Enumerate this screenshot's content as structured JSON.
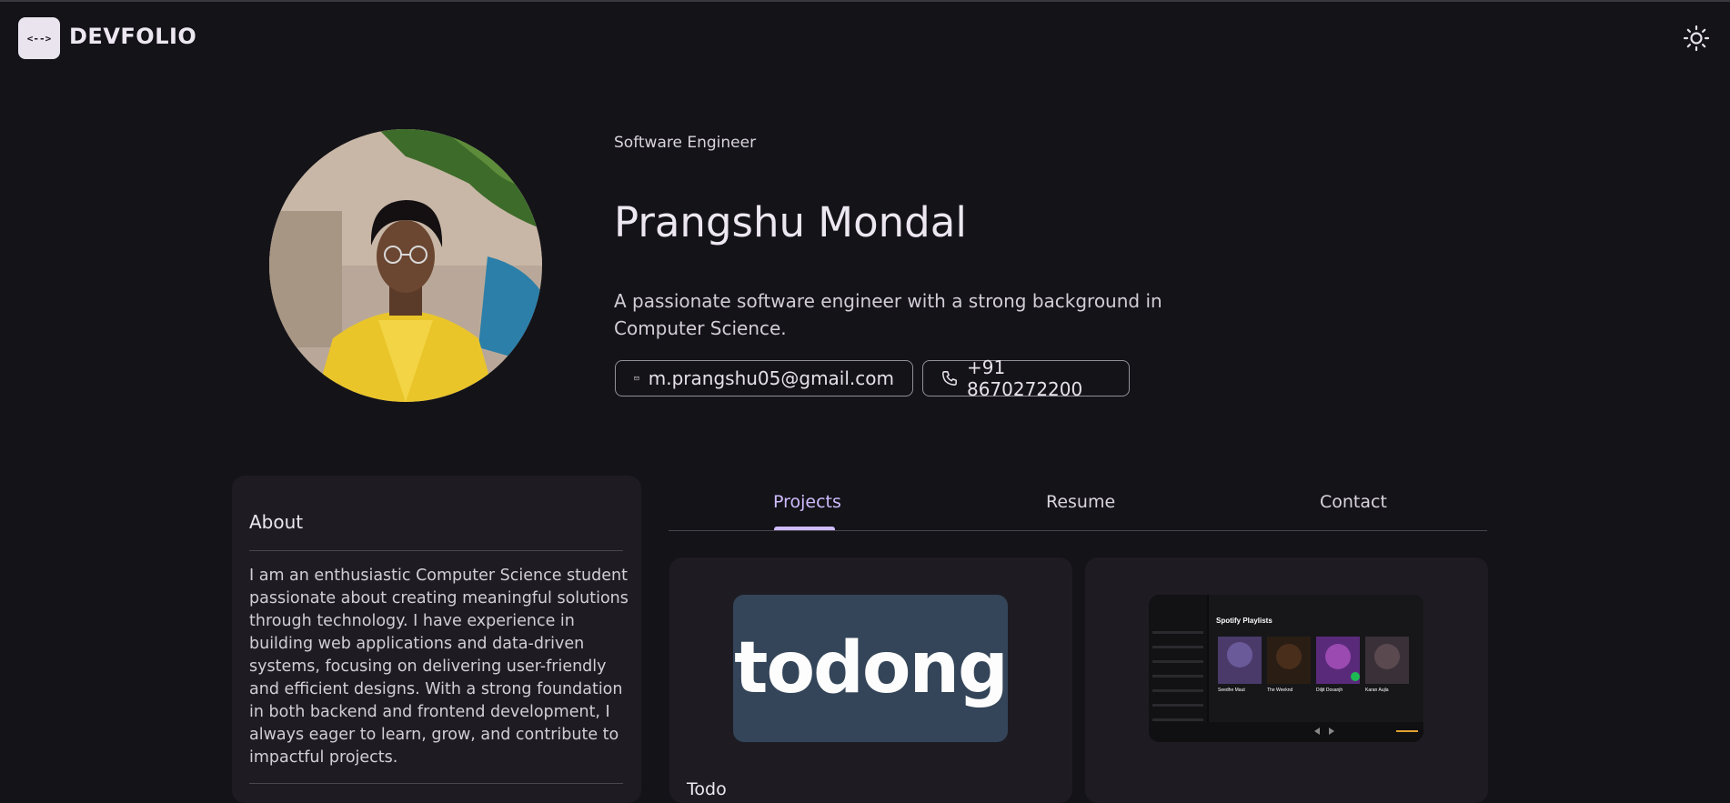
{
  "header": {
    "logo_glyph": "<-->",
    "brand": "DEVFOLIO",
    "theme_toggle_icon": "sun-icon"
  },
  "profile": {
    "role": "Software Engineer",
    "name": "Prangshu Mondal",
    "description": "A passionate software engineer with a strong background in Computer Science.",
    "email": "m.prangshu05@gmail.com",
    "phone": "+91 8670272200",
    "email_icon": "mail-icon",
    "phone_icon": "phone-icon"
  },
  "about": {
    "title": "About",
    "text": "I am an enthusiastic Computer Science student passionate about creating meaningful solutions through technology. I have experience in building web applications and data-driven systems, focusing on delivering user-friendly and efficient designs. With a strong foundation in both backend and frontend development, I always eager to learn, grow, and contribute to impactful projects."
  },
  "tabs": [
    {
      "label": "Projects",
      "active": true
    },
    {
      "label": "Resume",
      "active": false
    },
    {
      "label": "Contact",
      "active": false
    }
  ],
  "projects": [
    {
      "thumbnail_text": "todong",
      "title": "Todo"
    },
    {
      "thumbnail_title": "Spotify Playlists",
      "thumbnail_artists": [
        "Seedhe Maut",
        "The Weeknd",
        "Diljit Dosanjh",
        "Karan Aujla"
      ]
    }
  ],
  "colors": {
    "background": "#141318",
    "card": "#1e1c22",
    "accent": "#cfbcff",
    "todo_thumb": "#344559"
  }
}
